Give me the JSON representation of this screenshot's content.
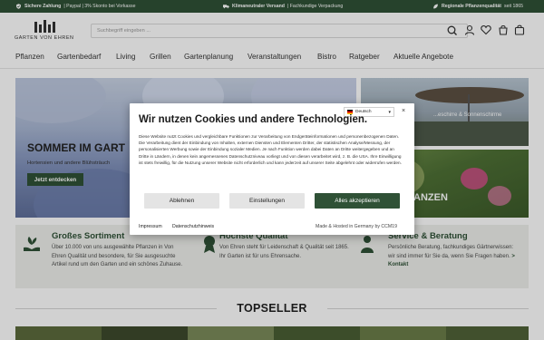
{
  "topbar": {
    "item1_bold": "Sichere Zahlung",
    "item1_rest": "| Paypal | 3% Skonto bei Vorkasse",
    "item2_bold": "Klimaneutraler Versand",
    "item2_rest": "| Fachkundige Verpackung",
    "item3_bold": "Regionale Pflanzenqualität",
    "item3_rest": "seit 1865"
  },
  "header": {
    "logo_text": "GARTEN VON EHREN",
    "search_placeholder": "Suchbegriff eingeben ...",
    "icons": [
      "search-icon",
      "user-icon",
      "heart-icon",
      "bag-icon",
      "cart-icon"
    ]
  },
  "nav": {
    "items": [
      "Pflanzen",
      "Gartenbedarf",
      "Living",
      "Grillen",
      "Gartenplanung",
      "Veranstaltungen",
      "Bistro",
      "Ratgeber",
      "Aktuelle Angebote"
    ]
  },
  "hero": {
    "title": "SOMMER IM GART",
    "subtitle": "Hortensien und andere Blühsträuch",
    "button": "Jetzt entdecken",
    "right_top_text": "...eschirre & Sonnenschirme",
    "right_bottom_text": "ANZEN"
  },
  "features": [
    {
      "icon": "plant-hands-icon",
      "title": "Großes Sortiment",
      "text": "Über 10.000 von uns ausgewählte Pflanzen in Von Ehren Qualität und besondere, für Sie ausgesuchte Artikel rund um den Garten und ein schönes Zuhause."
    },
    {
      "icon": "quality-icon",
      "title": "Höchste Qualität",
      "text": "Von Ehren steht für Leidenschaft & Qualität seit 1865. Ihr Garten ist für uns Ehrensache."
    },
    {
      "icon": "service-icon",
      "title": "Service & Beratung",
      "text": "Persönliche Beratung, fachkundiges Gärtnerwissen: wir sind immer für Sie da, wenn Sie Fragen haben.",
      "link": "> Kontakt"
    }
  ],
  "topseller": {
    "title": "TOPSELLER"
  },
  "cookie_modal": {
    "language": "Deutsch",
    "title": "Wir nutzen Cookies und andere Technologien.",
    "body": "Diese Website nutzt Cookies und vergleichbare Funktionen zur Verarbeitung von Endgeräteinformationen und personenbezogenen Daten. Die Verarbeitung dient der Einbindung von Inhalten, externen Diensten und Elementen Dritter, der statistischen Analyse/Messung, der personalisierten Werbung sowie der Einbindung sozialer Medien. Je nach Funktion werden dabei Daten an Dritte weitergegeben und an Dritte in Ländern, in denen kein angemessenes Datenschutzniveau vorliegt und von diesen verarbeitet wird, z. B. die USA. Ihre Einwilligung ist stets freiwillig, für die Nutzung unserer Website nicht erforderlich und kann jederzeit auf unserer Seite abgelehnt oder widerrufen werden.",
    "btn_decline": "Ablehnen",
    "btn_settings": "Einstellungen",
    "btn_accept": "Alles akzeptieren",
    "link_imprint": "Impressum",
    "link_privacy": "Datenschutzhinweis",
    "made_by": "Made & Hosted in Germany by CCM19"
  },
  "colors": {
    "brand_green": "#2f5136",
    "feature_bg": "#eef0ec"
  }
}
